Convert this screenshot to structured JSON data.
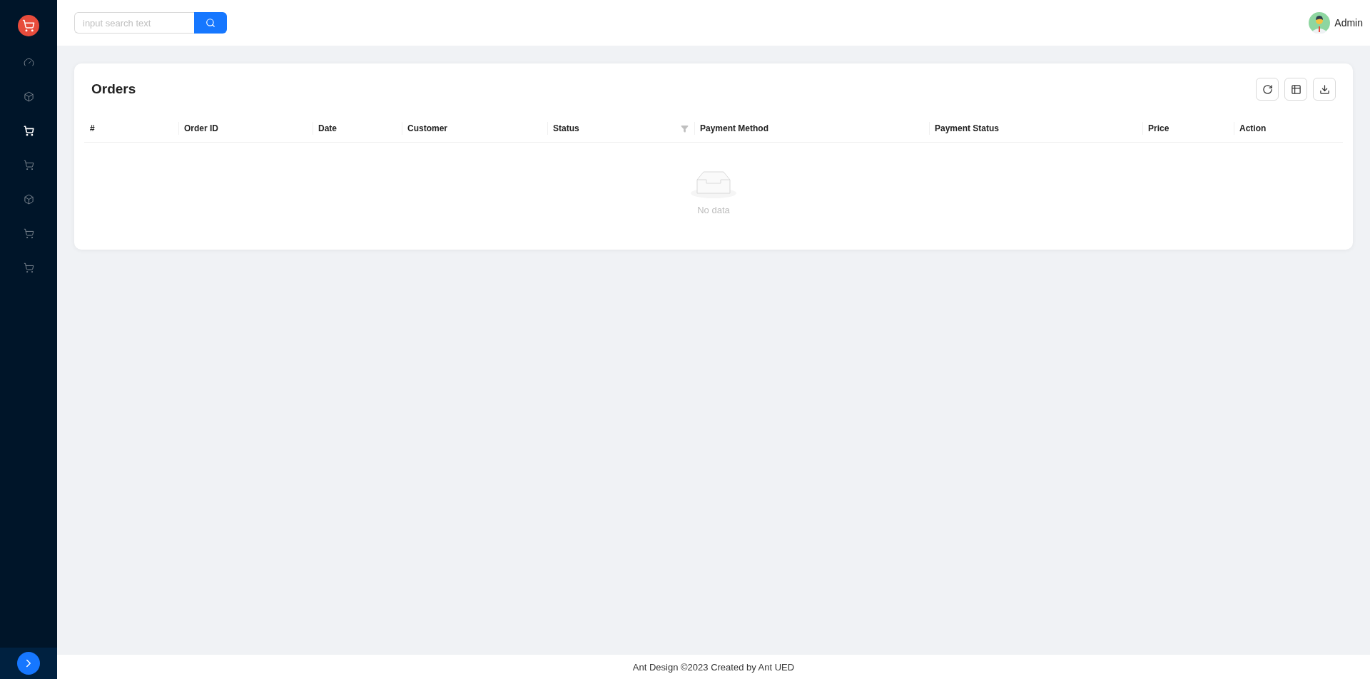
{
  "sidebar": {
    "items": [
      {
        "kind": "dashboard",
        "selected": false
      },
      {
        "kind": "box",
        "selected": false
      },
      {
        "kind": "cart",
        "selected": true
      },
      {
        "kind": "cart",
        "selected": false
      },
      {
        "kind": "box",
        "selected": false
      },
      {
        "kind": "cart",
        "selected": false
      },
      {
        "kind": "cart",
        "selected": false
      }
    ],
    "collapsed": true
  },
  "header": {
    "search": {
      "placeholder": "input search text"
    },
    "user": {
      "name": "Admin"
    }
  },
  "card": {
    "title": "Orders",
    "table": {
      "columns": [
        {
          "label": "#",
          "filter": false
        },
        {
          "label": "Order ID",
          "filter": false
        },
        {
          "label": "Date",
          "filter": false
        },
        {
          "label": "Customer",
          "filter": false
        },
        {
          "label": "Status",
          "filter": true
        },
        {
          "label": "Payment Method",
          "filter": false
        },
        {
          "label": "Payment Status",
          "filter": false
        },
        {
          "label": "Price",
          "filter": false
        },
        {
          "label": "Action",
          "filter": false
        }
      ],
      "empty_text": "No data"
    }
  },
  "footer": "Ant Design ©2023 Created by Ant UED"
}
